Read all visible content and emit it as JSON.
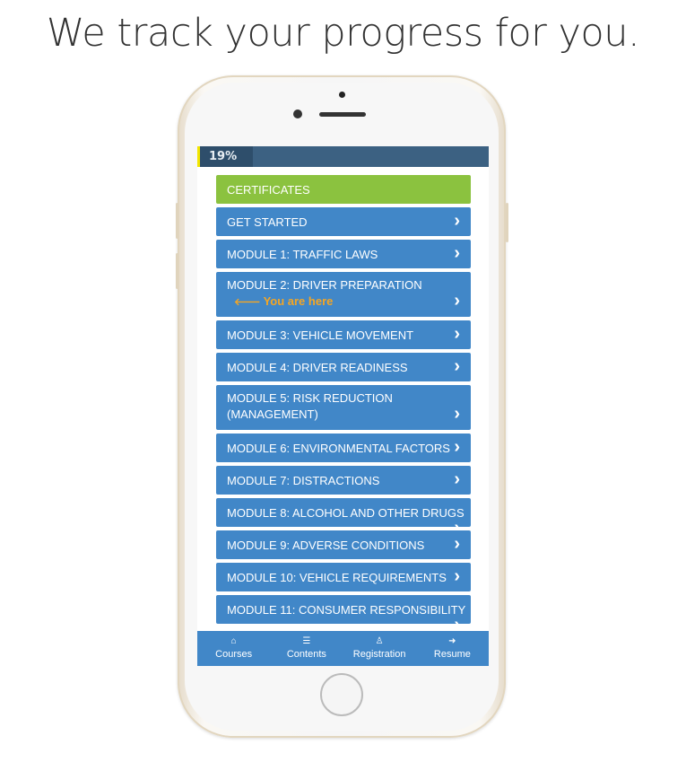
{
  "headline": "We track your progress for you.",
  "progress": {
    "label": "19%",
    "value": 19
  },
  "menu": [
    {
      "label": "CERTIFICATES",
      "color": "#8bc23f"
    },
    {
      "label": "GET STARTED"
    },
    {
      "label": "MODULE 1: TRAFFIC LAWS"
    },
    {
      "label": "MODULE 2: DRIVER PREPARATION",
      "marker": "You are here"
    },
    {
      "label": "MODULE 3: VEHICLE MOVEMENT"
    },
    {
      "label": "MODULE 4: DRIVER READINESS"
    },
    {
      "label": "MODULE 5: RISK REDUCTION (MANAGEMENT)"
    },
    {
      "label": "MODULE 6: ENVIRONMENTAL FACTORS"
    },
    {
      "label": "MODULE 7: DISTRACTIONS"
    },
    {
      "label": "MODULE 8: ALCOHOL AND OTHER DRUGS"
    },
    {
      "label": "MODULE 9: ADVERSE CONDITIONS"
    },
    {
      "label": "MODULE 10: VEHICLE REQUIREMENTS"
    },
    {
      "label": "MODULE 11: CONSUMER RESPONSIBILITY"
    }
  ],
  "nav": [
    {
      "label": "Courses",
      "icon": "home-icon"
    },
    {
      "label": "Contents",
      "icon": "list-icon"
    },
    {
      "label": "Registration",
      "icon": "user-icon"
    },
    {
      "label": "Resume",
      "icon": "arrow-right-icon"
    }
  ],
  "colors": {
    "primary": "#4187c8",
    "green": "#8bc23f",
    "progress": "#3c6182",
    "marker": "#f5a623"
  }
}
